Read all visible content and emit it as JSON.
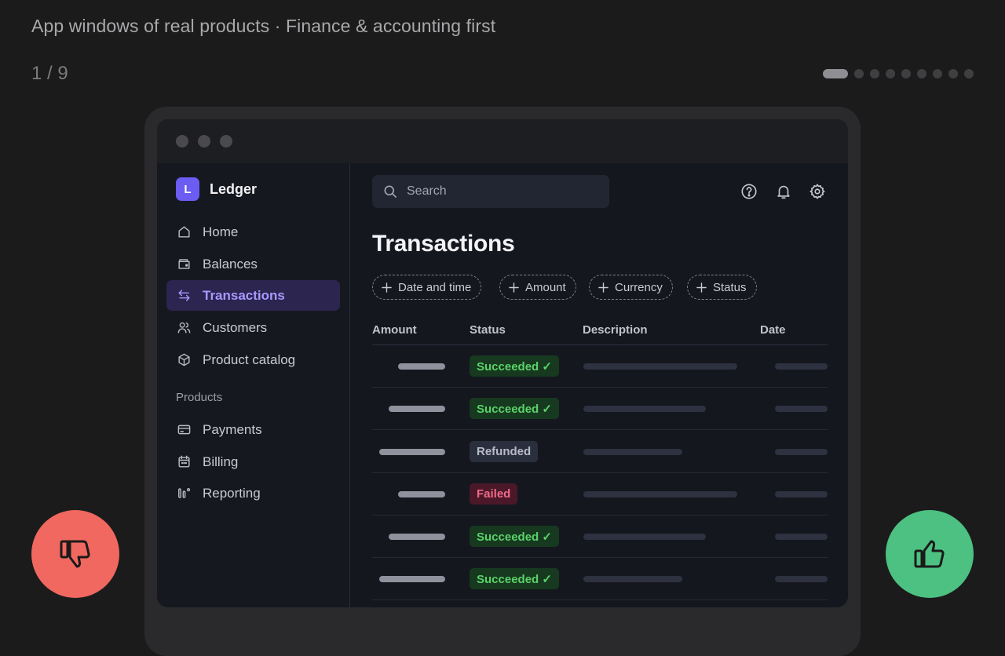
{
  "page": {
    "heading": "App windows of real products · Finance & accounting first",
    "counter": "1 / 9",
    "dot_count": 9,
    "active_dot": 1
  },
  "app": {
    "name": "Ledger",
    "logo_letter": "L",
    "accent_color": "#6b5cf2"
  },
  "sidebar": {
    "items": [
      {
        "label": "Home",
        "icon": "home-icon"
      },
      {
        "label": "Balances",
        "icon": "wallet-icon"
      },
      {
        "label": "Transactions",
        "icon": "transfer-arrows-icon",
        "active": true
      },
      {
        "label": "Customers",
        "icon": "users-icon"
      },
      {
        "label": "Product catalog",
        "icon": "box-icon"
      }
    ],
    "section_label": "Products",
    "product_items": [
      {
        "label": "Payments",
        "icon": "credit-card-icon"
      },
      {
        "label": "Billing",
        "icon": "calendar-icon"
      },
      {
        "label": "Reporting",
        "icon": "reporting-icon"
      }
    ]
  },
  "search": {
    "placeholder": "Search"
  },
  "header_icons": [
    "help-icon",
    "bell-icon",
    "gear-icon"
  ],
  "main": {
    "title": "Transactions",
    "filters": [
      "Date and time",
      "Amount",
      "Currency",
      "Status"
    ],
    "columns": [
      "Amount",
      "Status",
      "Description",
      "Date"
    ],
    "rows": [
      {
        "status": "Succeeded ✓",
        "kind": "succeeded"
      },
      {
        "status": "Succeeded ✓",
        "kind": "succeeded"
      },
      {
        "status": "Refunded",
        "kind": "refunded"
      },
      {
        "status": "Failed",
        "kind": "failed"
      },
      {
        "status": "Succeeded ✓",
        "kind": "succeeded"
      },
      {
        "status": "Succeeded ✓",
        "kind": "succeeded"
      }
    ]
  },
  "actions": {
    "dislike_icon": "thumbs-down-icon",
    "like_icon": "thumbs-up-icon",
    "dislike_color": "#f0685f",
    "like_color": "#4cc181"
  }
}
